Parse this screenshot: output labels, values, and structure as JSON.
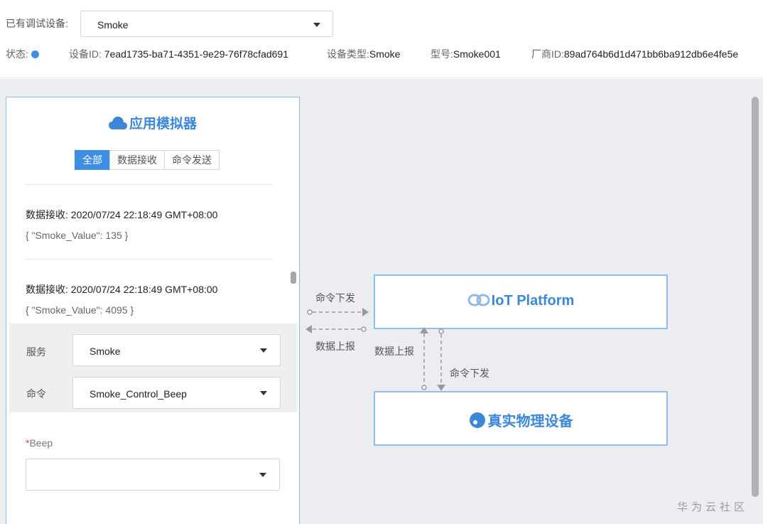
{
  "header": {
    "device_label": "已有调试设备:",
    "device_selected": "Smoke",
    "status_label": "状态:",
    "device_id_label": "设备ID:",
    "device_id": "7ead1735-ba71-4351-9e29-76f78cfad691",
    "device_type_label": "设备类型:",
    "device_type": "Smoke",
    "model_label": "型号:",
    "model": "Smoke001",
    "vendor_label": "厂商ID:",
    "vendor_id": "89ad764b6d1d471bb6ba912db6e4fe5e",
    "status_color": "#3b8ee6"
  },
  "simulator": {
    "title": "应用模拟器",
    "tabs": [
      {
        "label": "全部",
        "active": true
      },
      {
        "label": "数据接收",
        "active": false
      },
      {
        "label": "命令发送",
        "active": false
      }
    ],
    "log": [
      {
        "label": "数据接收",
        "time": ": 2020/07/24 22:18:49 GMT+08:00",
        "payload": "{ \"Smoke_Value\": 135 }"
      },
      {
        "label": "数据接收",
        "time": ": 2020/07/24 22:18:49 GMT+08:00",
        "payload": "{ \"Smoke_Value\": 4095 }"
      }
    ],
    "service_label": "服务",
    "service_value": "Smoke",
    "command_label": "命令",
    "command_value": "Smoke_Control_Beep",
    "beep_required": "*",
    "beep_label": "Beep",
    "beep_value": ""
  },
  "diagram": {
    "platform_label": "IoT Platform",
    "device_label": "真实物理设备",
    "cmd_down_top": "命令下发",
    "data_up_top": "数据上报",
    "data_up_side": "数据上报",
    "cmd_down_side": "命令下发"
  },
  "watermark": "华为云社区",
  "colors": {
    "accent": "#3d87d8",
    "border": "#90bdea",
    "tab_active": "#3d8de3"
  }
}
